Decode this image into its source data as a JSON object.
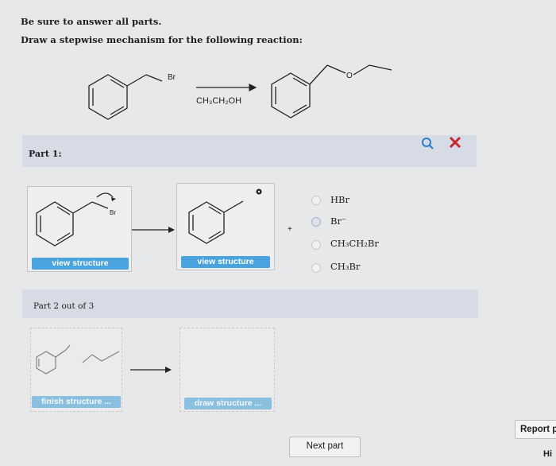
{
  "instructions": {
    "line1": "Be sure to answer all parts.",
    "line2": "Draw a stepwise mechanism for the following reaction:"
  },
  "reaction": {
    "reactant_label": "Br",
    "reagent": "CH₃CH₂OH",
    "product_label": "O"
  },
  "part1": {
    "title": "Part 1:",
    "reactant_label": "Br",
    "btn1": "view structure",
    "btn2": "view structure",
    "plus": "+",
    "options": [
      "HBr",
      "Br⁻",
      "CH₃CH₂Br",
      "CH₃Br"
    ]
  },
  "part2": {
    "title": "Part 2 out of 3",
    "btn1": "finish structure ...",
    "btn2": "draw structure ..."
  },
  "footer": {
    "next": "Next part",
    "report": "Report p",
    "hint": "Hi"
  },
  "icons": [
    "search-icon",
    "close-icon"
  ],
  "colors": {
    "band": "#d6dbe6",
    "button": "#4aa3dd",
    "close": "#c62828",
    "search": "#2f7ec7"
  }
}
